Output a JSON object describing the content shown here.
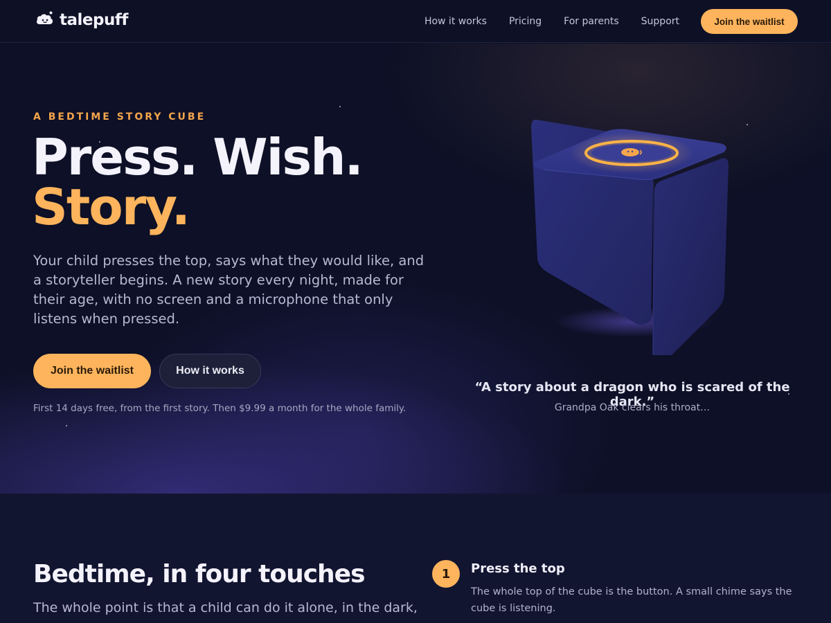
{
  "brand": {
    "name": "talepuff",
    "logo_icon": "cloud-face-icon"
  },
  "nav": {
    "links": [
      "How it works",
      "Pricing",
      "For parents",
      "Support"
    ],
    "cta": "Join the waitlist"
  },
  "hero": {
    "eyebrow": "A BEDTIME STORY CUBE",
    "headline_line1": "Press. Wish.",
    "headline_line2": "Story.",
    "lede": "Your child presses the top, says what they would like, and a storyteller begins. A new story every night, made for their age, with no screen and a microphone that only listens when pressed.",
    "primary_cta": "Join the waitlist",
    "secondary_cta": "How it works",
    "fineprint": "First 14 days free, from the first story. Then $9.99 a month for the whole family.",
    "quote": "“A story about a dragon who is scared of the dark.”",
    "quote_sub": "Grandpa Oak clears his throat…"
  },
  "how_it_works": {
    "title": "Bedtime, in four touches",
    "body": "The whole point is that a child can do it alone, in the dark,",
    "steps": [
      {
        "number": "1",
        "title": "Press the top",
        "body": "The whole top of the cube is the button. A small chime says the cube is listening."
      }
    ]
  },
  "colors": {
    "accent": "#fdb45c",
    "eyebrow": "#f5a54c",
    "background": "#0d1026",
    "cube": "#2a2d78"
  }
}
